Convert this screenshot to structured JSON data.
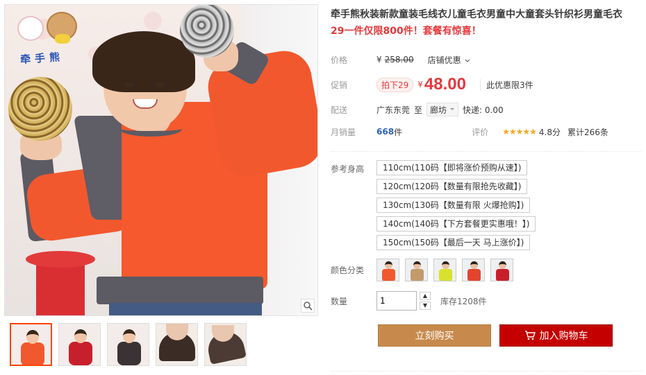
{
  "brand": {
    "logo_text": "牵手熊"
  },
  "product": {
    "title": "牵手熊秋装新款童装毛线衣儿童毛衣男童中大童套头针织衫男童毛衣",
    "promo": "29一件仅限800件！套餐有惊喜！"
  },
  "price": {
    "label": "价格",
    "currency": "¥",
    "original": "258.00",
    "discount_link": "店铺优惠"
  },
  "promotion": {
    "label": "促销",
    "tag": "拍下29",
    "currency": "¥",
    "value": "48.00",
    "limit": "此优惠限3件"
  },
  "delivery": {
    "label": "配送",
    "from": "广东东莞",
    "to_word": "至",
    "city": "廊坊",
    "shipping": "快递: 0.00"
  },
  "sales": {
    "label": "月销量",
    "count": "668",
    "unit": "件",
    "rating_label": "评价",
    "stars": "★★★★★",
    "score": "4.8分",
    "total_reviews": "累计266条"
  },
  "options": {
    "size_label": "参考身高",
    "sizes": [
      "110cm(110码【即将涨价预购从速】)",
      "120cm(120码【数量有限抢先收藏】)",
      "130cm(130码【数量有限 火爆抢购】)",
      "140cm(140码【下方套餐更实惠哦！】)",
      "150cm(150码【最后一天 马上涨价】)"
    ],
    "color_label": "颜色分类",
    "colors": [
      "#f2582e",
      "#c49a6c",
      "#d7e12f",
      "#e2442d",
      "#c7202c"
    ]
  },
  "quantity": {
    "label": "数量",
    "value": "1",
    "up": "▲",
    "down": "▼",
    "stock": "库存1208件"
  },
  "actions": {
    "buy_now": "立刻购买",
    "add_to_cart": "加入购物车"
  },
  "icons": {
    "zoom": "magnifier-icon",
    "cart": "cart-icon",
    "dropdown": "chevron-down-icon"
  }
}
